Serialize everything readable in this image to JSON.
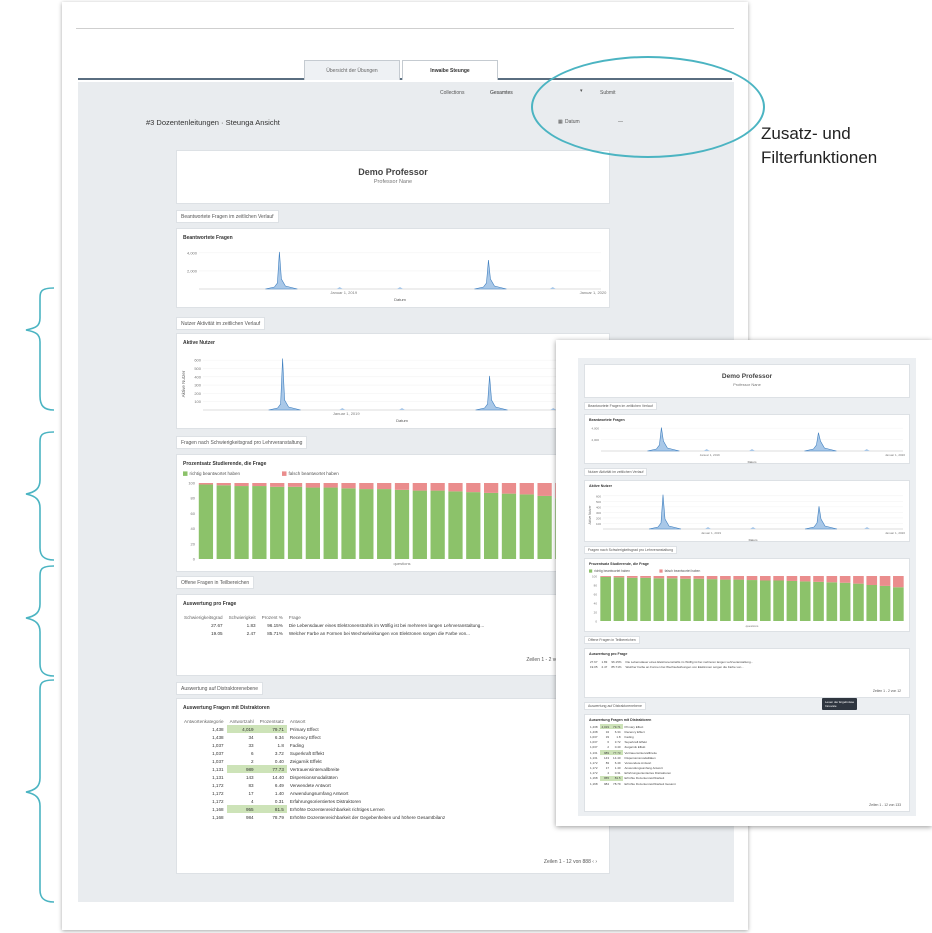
{
  "tabs": [
    {
      "label": "Übersicht der Übungen"
    },
    {
      "label": "Inwaibe Steunge"
    }
  ],
  "toolbar": {
    "filter_label": "Collections",
    "filter_value": "Gesamtes",
    "dropdown_glyph": "▾",
    "submit_label": "Submit",
    "date_label": "Datum",
    "date_value": "—"
  },
  "page_heading": "#3 Dozentenleitungen · Steunga Ansicht",
  "callout": {
    "line1": "Zusatz- und",
    "line2": "Filterfunktionen"
  },
  "report": {
    "professor_name": "Demo Professor",
    "professor_sub": "Professor Nane",
    "sections": {
      "questions_time": "Beantwortete Fragen im zeitlichen Verlauf",
      "users_time": "Nutzer Aktivität im zeitlichen Verlauf",
      "difficulty": "Fragen nach Schwierigkeitsgrad pro Lehrveranstaltung",
      "open_questions": "Offene Fragen in Teilbereichen",
      "by_distractor": "Auswertung auf Distraktorenebene"
    },
    "cards": {
      "answered_title": "Beantwortete Fragen",
      "active_title": "Aktive Nutzer",
      "active_ylabel": "Aktive Nutzer",
      "difficulty_title": "Prozentsatz Studierende, die Frage",
      "eval_title": "Auswertung pro Frage",
      "distractor_title": "Auswertung Fragen mit Distraktoren"
    },
    "x_axis_label": "Datum",
    "date_tick_1": "Januar 1, 2019",
    "date_tick_2": "Januar 1, 2020",
    "legend_correct": "richtig beantwortet haben",
    "legend_wrong": "falsch beantwortet haben",
    "bar_axis_label": "questions",
    "eval_headers": [
      "Schwierigkeitsgrad",
      "Schwierigkeit",
      "Prozent %",
      "Frage"
    ],
    "eval_rows": [
      {
        "a": "27.67",
        "b": "1.83",
        "c": "96.15%",
        "q": "Die Lebensdauer eines Elektronenstrahls im Wölfig ist bei mehreren langen Lehrveranstaltung..."
      },
      {
        "a": "19.05",
        "b": "2.47",
        "c": "85.71%",
        "q": "Welcher Farbe an Formen bei Wechselwirkungen von Elektronen sorgen die Farbe von..."
      }
    ],
    "eval_pager": "Zeilen 1 - 2 von 2",
    "dist_headers": [
      "Antwortenkategorie",
      "Antwortzahl",
      "Prozentsatz",
      "Antwort"
    ],
    "dist_rows": [
      {
        "a": "1,438",
        "b": "4,019",
        "c": "79.71",
        "t": "Primary Effect",
        "hl": true
      },
      {
        "a": "1,438",
        "b": "34",
        "c": "6.34",
        "t": "Recency Effect",
        "hl": false
      },
      {
        "a": "1,037",
        "b": "33",
        "c": "1.8",
        "t": "Fading",
        "hl": false
      },
      {
        "a": "1,037",
        "b": "6",
        "c": "3.72",
        "t": "Superkraft Effekt",
        "hl": false
      },
      {
        "a": "1,037",
        "b": "2",
        "c": "0.40",
        "t": "Zeigarnik Effekt",
        "hl": false
      },
      {
        "a": "1,131",
        "b": "989",
        "c": "77.73",
        "t": "Vertrauensintervallbreite",
        "hl": true
      },
      {
        "a": "1,131",
        "b": "143",
        "c": "14.40",
        "t": "Dispersionsmodalitäten",
        "hl": false
      },
      {
        "a": "1,172",
        "b": "83",
        "c": "6.49",
        "t": "Verwendete Antwort",
        "hl": false
      },
      {
        "a": "1,172",
        "b": "17",
        "c": "1.40",
        "t": "Anwendungsumfang Antwort",
        "hl": false
      },
      {
        "a": "1,172",
        "b": "4",
        "c": "0.31",
        "t": "Erfahrungsorientiertes Distraktoren",
        "hl": false
      },
      {
        "a": "1,168",
        "b": "955",
        "c": "81.5",
        "t": "Erhöhte Dozentenreichbarkeit richtiges Lernen",
        "hl": true
      },
      {
        "a": "1,168",
        "b": "984",
        "c": "78.79",
        "t": "Erhöhte Dozentenreichbarkeit der Gegebenheiten und höhere Gesamtbilanz",
        "hl": false
      }
    ],
    "dist_pager": "Zeilen 1 - 12 von 888",
    "pager_nav": "‹ ›"
  },
  "mini": {
    "professor_name": "Demo Professor",
    "professor_sub": "Professor Nane",
    "tooltip_line1": "Lesen der Ergebnisse",
    "tooltip_line2": "Innovate",
    "eval_pager": "Zeilen 1 - 2 von 12",
    "dist_pager": "Zeilen 1 - 12 von 133",
    "dist_rows": [
      {
        "a": "1,438",
        "b": "4,019",
        "c": "79.71",
        "t": "Primary Effect",
        "hl": true
      },
      {
        "a": "1,438",
        "b": "34",
        "c": "6.34",
        "t": "Recency Effect",
        "hl": false
      },
      {
        "a": "1,037",
        "b": "33",
        "c": "1.8",
        "t": "Fading",
        "hl": false
      },
      {
        "a": "1,037",
        "b": "6",
        "c": "3.72",
        "t": "Superkraft Effekt",
        "hl": false
      },
      {
        "a": "1,037",
        "b": "2",
        "c": "0.40",
        "t": "Zeigarnik Effekt",
        "hl": false
      },
      {
        "a": "1,131",
        "b": "989",
        "c": "77.73",
        "t": "Vertrauensintervallbreite",
        "hl": true
      },
      {
        "a": "1,131",
        "b": "143",
        "c": "14.40",
        "t": "Dispersionsmodalitäten",
        "hl": false
      },
      {
        "a": "1,172",
        "b": "83",
        "c": "6.49",
        "t": "Verwendete Antwort",
        "hl": false
      },
      {
        "a": "1,172",
        "b": "17",
        "c": "1.40",
        "t": "Anwendungsumfang Antwort",
        "hl": false
      },
      {
        "a": "1,172",
        "b": "4",
        "c": "0.31",
        "t": "Erfahrungsorientiertes Distraktoren",
        "hl": false
      },
      {
        "a": "1,168",
        "b": "955",
        "c": "81.5",
        "t": "Erhöhte Dozentenreichbarkeit",
        "hl": true
      },
      {
        "a": "1,168",
        "b": "984",
        "c": "78.79",
        "t": "Erhöhte Dozentenreichbarkeit Gesamt",
        "hl": false
      }
    ]
  },
  "colors": {
    "accent_callout": "#4bb4c2",
    "bar_correct": "#8cc26a",
    "bar_wrong": "#ea8d8d",
    "line_fill": "#a9c8e8",
    "line_stroke": "#3f7fbf"
  },
  "chart_data": [
    {
      "type": "area",
      "title": "Beantwortete Fragen",
      "xlabel": "Datum",
      "x_ticks": [
        "Januar 1, 2019",
        "Januar 1, 2020"
      ],
      "y_ticks": [
        "4,000",
        "2,000"
      ],
      "peaks": [
        {
          "x": "Januar 2019",
          "y": 4100
        },
        {
          "x": "Januar 2020",
          "y": 3200
        }
      ]
    },
    {
      "type": "area",
      "title": "Aktive Nutzer",
      "ylabel": "Aktive Nutzer",
      "xlabel": "Datum",
      "x_ticks": [
        "Januar 1, 2019",
        "Januar 1, 2020"
      ],
      "y_ticks": [
        "600",
        "500",
        "400",
        "300",
        "200",
        "100"
      ],
      "peaks": [
        {
          "x": "Januar 2019",
          "y": 620
        },
        {
          "x": "Januar 2020",
          "y": 410
        }
      ]
    },
    {
      "type": "bar",
      "title": "Prozentsatz Studierende, die Frage",
      "stacked": true,
      "legend": [
        "richtig beantwortet haben",
        "falsch beantwortet haben"
      ],
      "xlabel": "questions",
      "y_ticks": [
        "100",
        "80",
        "60",
        "40",
        "20",
        "0"
      ],
      "ylim": [
        0,
        100
      ],
      "series": [
        {
          "name": "richtig beantwortet haben",
          "values": [
            98,
            97,
            96,
            96,
            95,
            95,
            94,
            94,
            93,
            92,
            92,
            91,
            90,
            90,
            89,
            88,
            87,
            86,
            85,
            83,
            80,
            78,
            75
          ]
        },
        {
          "name": "falsch beantwortet haben",
          "values": [
            2,
            3,
            4,
            4,
            5,
            5,
            6,
            6,
            7,
            8,
            8,
            9,
            10,
            10,
            11,
            12,
            13,
            14,
            15,
            17,
            20,
            22,
            25
          ]
        }
      ]
    }
  ]
}
